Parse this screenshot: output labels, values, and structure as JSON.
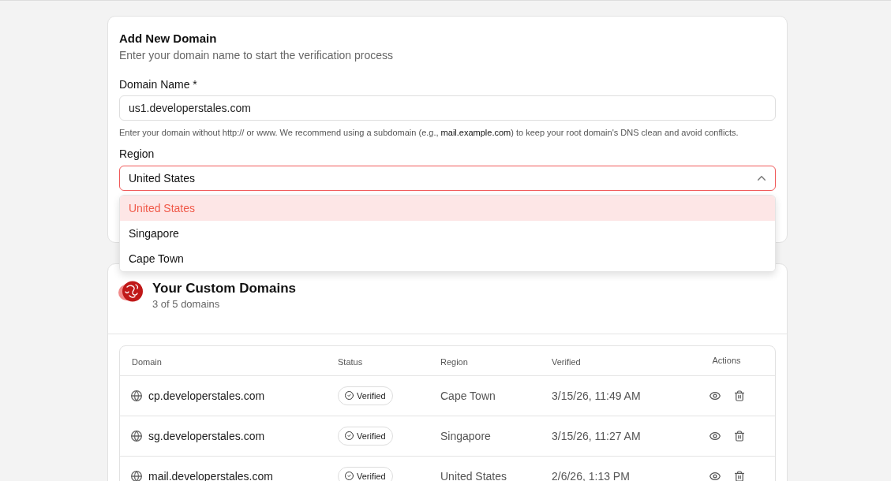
{
  "add_domain": {
    "title": "Add New Domain",
    "subtitle": "Enter your domain name to start the verification process",
    "domain_field": {
      "label": "Domain Name *",
      "value": "us1.developerstales.com"
    },
    "help_text": "Enter your domain without http:// or www. We recommend using a subdomain (e.g., **mail.example.com**) to keep your root domain's DNS clean and avoid conflicts.",
    "region_field": {
      "label": "Region",
      "value": "United States",
      "expanded": true,
      "options": [
        {
          "label": "United States",
          "selected": true
        },
        {
          "label": "Singapore",
          "selected": false
        },
        {
          "label": "Cape Town",
          "selected": false
        }
      ]
    }
  },
  "custom_domains": {
    "title": "Your Custom Domains",
    "count": "3 of 5 domains",
    "table": {
      "columns": [
        "Domain",
        "Status",
        "Region",
        "Verified",
        "Actions"
      ],
      "rows": [
        {
          "domain": "cp.developerstales.com",
          "status": "Verified",
          "region": "Cape Town",
          "verified": "3/15/26, 11:49 AM"
        },
        {
          "domain": "sg.developerstales.com",
          "status": "Verified",
          "region": "Singapore",
          "verified": "3/15/26, 11:27 AM"
        },
        {
          "domain": "mail.developerstales.com",
          "status": "Verified",
          "region": "United States",
          "verified": "2/6/26, 1:13 PM"
        }
      ]
    }
  }
}
